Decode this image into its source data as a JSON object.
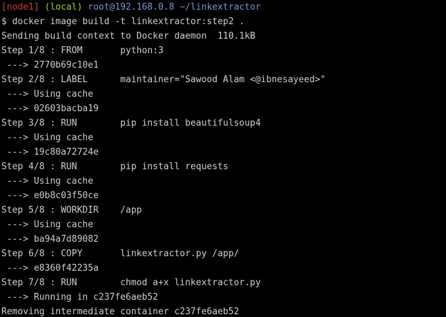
{
  "prompt": {
    "node": "[node1]",
    "local": "(local)",
    "host": "root@192.168.0.8",
    "path": "~/linkextractor",
    "colors": {
      "node": "#d23a3a",
      "local": "#9fd24a",
      "host": "#7c95d6",
      "text": "#d0d0d0",
      "background": "#000000"
    }
  },
  "output": [
    "$ docker image build -t linkextractor:step2 .",
    "Sending build context to Docker daemon  110.1kB",
    "Step 1/8 : FROM       python:3",
    " ---> 2770b69c10e1",
    "Step 2/8 : LABEL      maintainer=\"Sawood Alam <@ibnesayeed>\"",
    " ---> Using cache",
    " ---> 02603bacba19",
    "Step 3/8 : RUN        pip install beautifulsoup4",
    " ---> Using cache",
    " ---> 19c80a72724e",
    "Step 4/8 : RUN        pip install requests",
    " ---> Using cache",
    " ---> e0b8c03f50ce",
    "Step 5/8 : WORKDIR    /app",
    " ---> Using cache",
    " ---> ba94a7d89082",
    "Step 6/8 : COPY       linkextractor.py /app/",
    " ---> e8360f42235a",
    "Step 7/8 : RUN        chmod a+x linkextractor.py",
    " ---> Running in c237fe6aeb52",
    "Removing intermediate container c237fe6aeb52"
  ]
}
